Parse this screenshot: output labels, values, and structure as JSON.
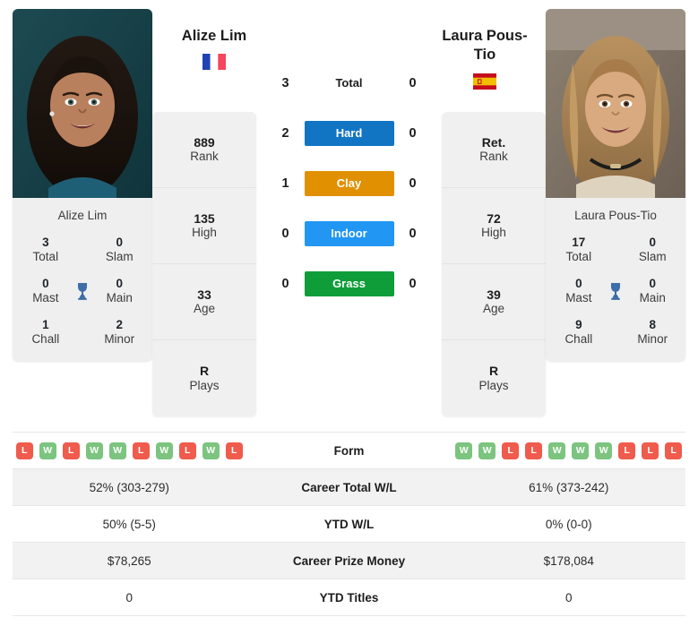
{
  "colors": {
    "hard": "#1175c4",
    "clay": "#e09000",
    "indoor": "#2196f3",
    "grass": "#0f9d3a",
    "win": "#7cc47f",
    "loss": "#ef5b4c",
    "trophy": "#3e6ea8",
    "card_bg": "#efefef",
    "row_alt": "#f2f2f2"
  },
  "left_player": {
    "name": "Alize Lim",
    "photo_caption": "Alize Lim",
    "flag": "france-flag-icon",
    "info": [
      {
        "value": "889",
        "label": "Rank"
      },
      {
        "value": "135",
        "label": "High"
      },
      {
        "value": "33",
        "label": "Age"
      },
      {
        "value": "R",
        "label": "Plays"
      }
    ],
    "titles": [
      {
        "left_value": "3",
        "left_label": "Total",
        "right_value": "0",
        "right_label": "Slam"
      },
      {
        "left_value": "0",
        "left_label": "Mast",
        "right_value": "0",
        "right_label": "Main"
      },
      {
        "left_value": "1",
        "left_label": "Chall",
        "right_value": "2",
        "right_label": "Minor"
      }
    ],
    "form": [
      "L",
      "W",
      "L",
      "W",
      "W",
      "L",
      "W",
      "L",
      "W",
      "L"
    ],
    "career_total_wl": "52% (303-279)",
    "ytd_wl": "50% (5-5)",
    "career_prize_money": "$78,265",
    "ytd_titles": "0"
  },
  "right_player": {
    "name": "Laura Pous-Tio",
    "photo_caption": "Laura Pous-Tio",
    "flag": "spain-flag-icon",
    "info": [
      {
        "value": "Ret.",
        "label": "Rank"
      },
      {
        "value": "72",
        "label": "High"
      },
      {
        "value": "39",
        "label": "Age"
      },
      {
        "value": "R",
        "label": "Plays"
      }
    ],
    "titles": [
      {
        "left_value": "17",
        "left_label": "Total",
        "right_value": "0",
        "right_label": "Slam"
      },
      {
        "left_value": "0",
        "left_label": "Mast",
        "right_value": "0",
        "right_label": "Main"
      },
      {
        "left_value": "9",
        "left_label": "Chall",
        "right_value": "8",
        "right_label": "Minor"
      }
    ],
    "form": [
      "W",
      "W",
      "L",
      "L",
      "W",
      "W",
      "W",
      "L",
      "L",
      "L"
    ],
    "career_total_wl": "61% (373-242)",
    "ytd_wl": "0% (0-0)",
    "career_prize_money": "$178,084",
    "ytd_titles": "0"
  },
  "h2h": [
    {
      "left": "3",
      "label": "Total",
      "right": "0",
      "type": "plain"
    },
    {
      "left": "2",
      "label": "Hard",
      "right": "0",
      "type": "badge",
      "color_key": "hard"
    },
    {
      "left": "1",
      "label": "Clay",
      "right": "0",
      "type": "badge",
      "color_key": "clay"
    },
    {
      "left": "0",
      "label": "Indoor",
      "right": "0",
      "type": "badge",
      "color_key": "indoor"
    },
    {
      "left": "0",
      "label": "Grass",
      "right": "0",
      "type": "badge",
      "color_key": "grass"
    }
  ],
  "table_rows": [
    {
      "label": "Form",
      "key": "form",
      "kind": "form"
    },
    {
      "label": "Career Total W/L",
      "key": "career_total_wl",
      "kind": "text"
    },
    {
      "label": "YTD W/L",
      "key": "ytd_wl",
      "kind": "text"
    },
    {
      "label": "Career Prize Money",
      "key": "career_prize_money",
      "kind": "text"
    },
    {
      "label": "YTD Titles",
      "key": "ytd_titles",
      "kind": "text"
    }
  ]
}
